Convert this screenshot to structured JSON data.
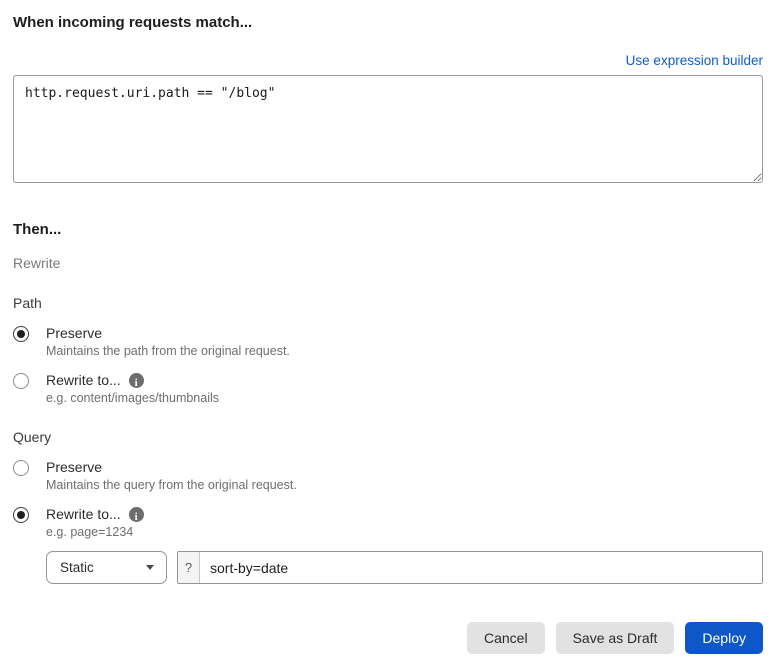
{
  "colors": {
    "accent_blue": "#0d57c8",
    "link_blue": "#0f5bd0",
    "secondary_button_gray": "#e2e2e2"
  },
  "match_section": {
    "heading": "When incoming requests match...",
    "expression_builder_link": "Use expression builder",
    "expression_value": "http.request.uri.path == \"/blog\""
  },
  "then_section": {
    "heading": "Then...",
    "action_label": "Rewrite",
    "path_group": {
      "label": "Path",
      "selected_option": "Preserve",
      "options": [
        {
          "label": "Preserve",
          "description": "Maintains the path from the original request.",
          "selected": true,
          "has_info_icon": false
        },
        {
          "label": "Rewrite to...",
          "description": "e.g. content/images/thumbnails",
          "selected": false,
          "has_info_icon": true
        }
      ]
    },
    "query_group": {
      "label": "Query",
      "selected_option": "Rewrite to...",
      "options": [
        {
          "label": "Preserve",
          "description": "Maintains the query from the original request.",
          "selected": false,
          "has_info_icon": false
        },
        {
          "label": "Rewrite to...",
          "description": "e.g. page=1234",
          "selected": true,
          "has_info_icon": true
        }
      ],
      "rewrite_controls": {
        "type_dropdown_value": "Static",
        "prefix": "?",
        "value_input": "sort-by=date"
      }
    }
  },
  "footer": {
    "cancel_label": "Cancel",
    "save_draft_label": "Save as Draft",
    "deploy_label": "Deploy"
  }
}
